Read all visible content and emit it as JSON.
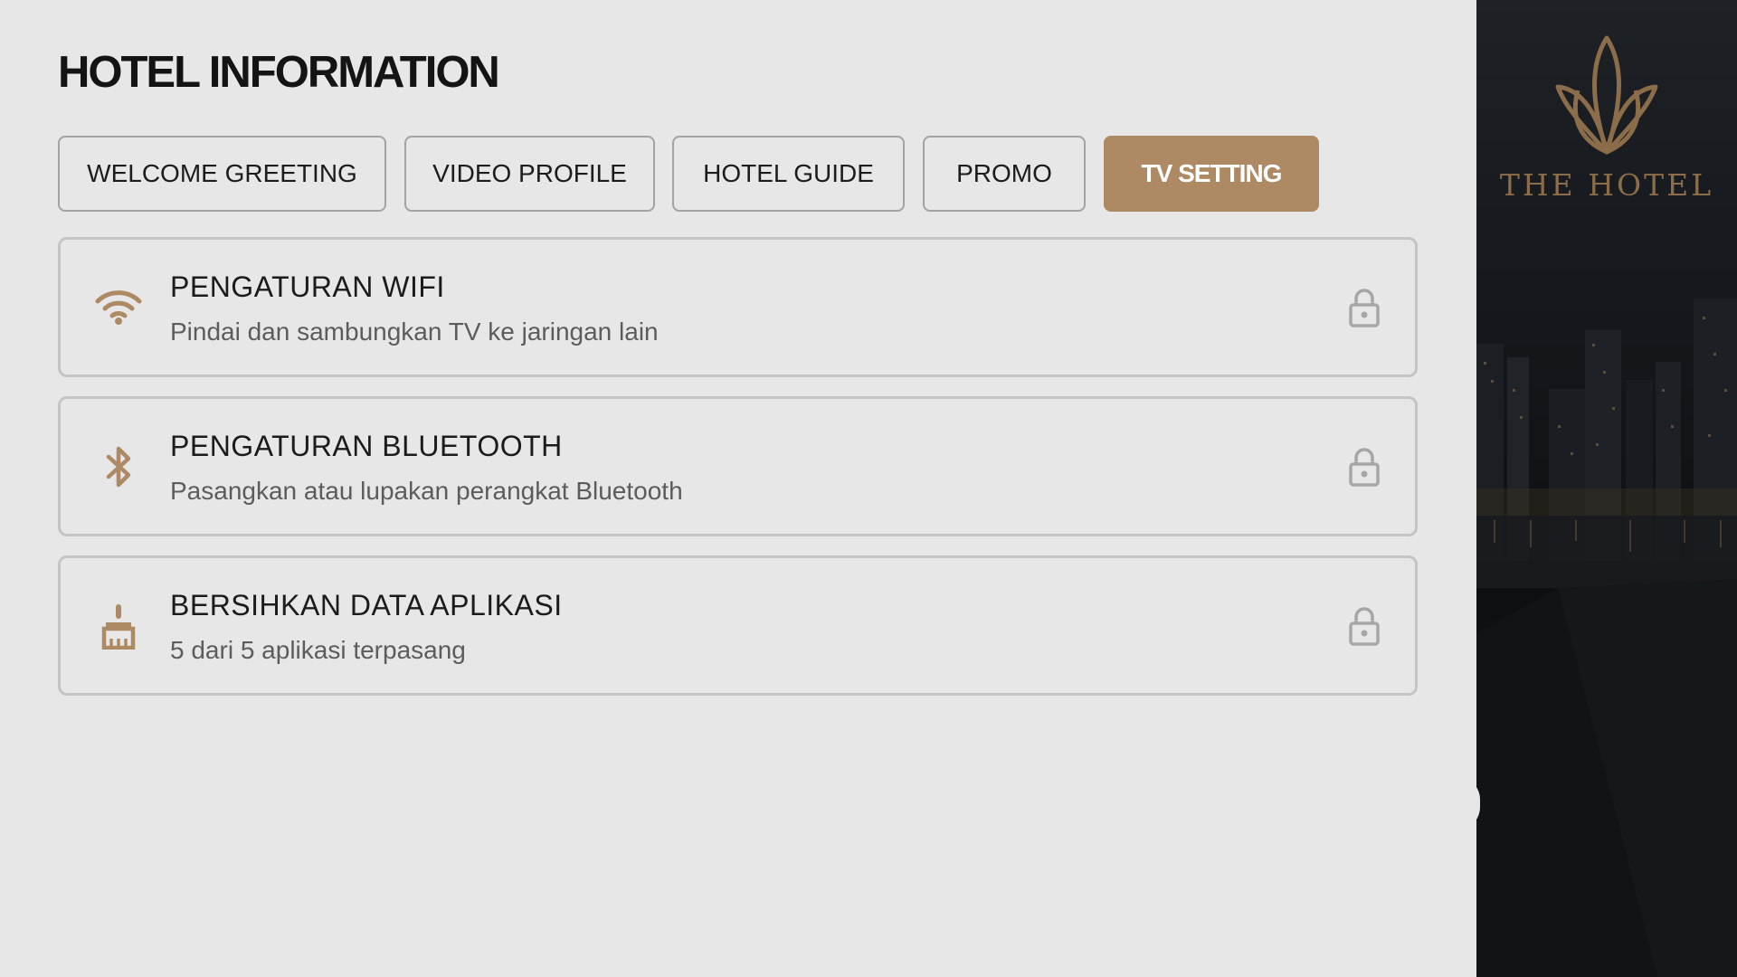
{
  "header": {
    "title": "HOTEL INFORMATION"
  },
  "tabs": [
    {
      "label": "WELCOME GREETING",
      "active": false
    },
    {
      "label": "VIDEO PROFILE",
      "active": false
    },
    {
      "label": "HOTEL GUIDE",
      "active": false
    },
    {
      "label": "PROMO",
      "active": false
    },
    {
      "label": "TV SETTING",
      "active": true
    }
  ],
  "settings": [
    {
      "icon": "wifi-icon",
      "title": "PENGATURAN WIFI",
      "subtitle": "Pindai dan sambungkan TV ke jaringan lain",
      "locked": true
    },
    {
      "icon": "bluetooth-icon",
      "title": "PENGATURAN BLUETOOTH",
      "subtitle": "Pasangkan atau lupakan perangkat Bluetooth",
      "locked": true
    },
    {
      "icon": "broom-icon",
      "title": "BERSIHKAN DATA APLIKASI",
      "subtitle": "5 dari 5 aplikasi terpasang",
      "locked": true
    }
  ],
  "sidebar": {
    "brand": "THE HOTEL",
    "logo_icon": "lotus-logo-icon"
  },
  "colors": {
    "accent": "#ad8a63",
    "background": "#e7e7e7",
    "border": "#c4c4c4",
    "lock": "#a6a6a6"
  }
}
